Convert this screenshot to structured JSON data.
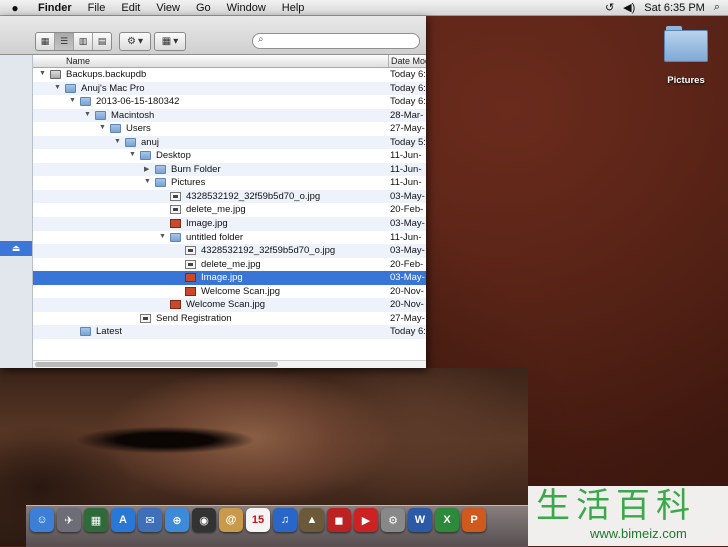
{
  "menubar": {
    "apple": "",
    "app": "Finder",
    "menus": [
      "File",
      "Edit",
      "View",
      "Go",
      "Window",
      "Help"
    ],
    "clock": "Sat 6:35 PM"
  },
  "toolbar": {
    "search_placeholder": ""
  },
  "list": {
    "col_name": "Name",
    "col_date": "Date Mod",
    "rows": [
      {
        "name": "Backups.backupdb",
        "date": "Today 6:",
        "indent": 0,
        "tri": "▼",
        "icon": "disk"
      },
      {
        "name": "Anuj's Mac Pro",
        "date": "Today 6:",
        "indent": 1,
        "tri": "▼",
        "icon": "folder"
      },
      {
        "name": "2013-06-15-180342",
        "date": "Today 6:",
        "indent": 2,
        "tri": "▼",
        "icon": "folder"
      },
      {
        "name": "Macintosh",
        "date": "28-Mar-",
        "indent": 3,
        "tri": "▼",
        "icon": "folder"
      },
      {
        "name": "Users",
        "date": "27-May-",
        "indent": 4,
        "tri": "▼",
        "icon": "folder"
      },
      {
        "name": "anuj",
        "date": "Today 5:",
        "indent": 5,
        "tri": "▼",
        "icon": "folder"
      },
      {
        "name": "Desktop",
        "date": "11-Jun-",
        "indent": 6,
        "tri": "▼",
        "icon": "folder"
      },
      {
        "name": "Burn Folder",
        "date": "11-Jun-",
        "indent": 7,
        "tri": "▶",
        "icon": "folder"
      },
      {
        "name": "Pictures",
        "date": "11-Jun-",
        "indent": 7,
        "tri": "▼",
        "icon": "folder"
      },
      {
        "name": "4328532192_32f59b5d70_o.jpg",
        "date": "03-May-",
        "indent": 8,
        "tri": "",
        "icon": "file"
      },
      {
        "name": "delete_me.jpg",
        "date": "20-Feb-",
        "indent": 8,
        "tri": "",
        "icon": "file"
      },
      {
        "name": "Image.jpg",
        "date": "03-May-",
        "indent": 8,
        "tri": "",
        "icon": "img-red"
      },
      {
        "name": "untitled folder",
        "date": "11-Jun-",
        "indent": 8,
        "tri": "▼",
        "icon": "folder"
      },
      {
        "name": "4328532192_32f59b5d70_o.jpg",
        "date": "03-May-",
        "indent": 9,
        "tri": "",
        "icon": "file"
      },
      {
        "name": "delete_me.jpg",
        "date": "20-Feb-",
        "indent": 9,
        "tri": "",
        "icon": "file"
      },
      {
        "name": "Image.jpg",
        "date": "03-May-",
        "indent": 9,
        "tri": "",
        "icon": "img-red",
        "selected": true
      },
      {
        "name": "Welcome Scan.jpg",
        "date": "20-Nov-",
        "indent": 9,
        "tri": "",
        "icon": "img-red"
      },
      {
        "name": "Welcome Scan.jpg",
        "date": "20-Nov-",
        "indent": 8,
        "tri": "",
        "icon": "img-red"
      },
      {
        "name": "Send Registration",
        "date": "27-May-",
        "indent": 6,
        "tri": "",
        "icon": "file"
      },
      {
        "name": "Latest",
        "date": "Today 6:",
        "indent": 2,
        "tri": "",
        "icon": "folder"
      }
    ]
  },
  "desktop": {
    "icon_label": "Pictures"
  },
  "dock": {
    "items": [
      {
        "name": "finder",
        "color": "#3d7fd6",
        "glyph": "☺"
      },
      {
        "name": "launchpad",
        "color": "#6d6d78",
        "glyph": "✈"
      },
      {
        "name": "mission-control",
        "color": "#2f6b3a",
        "glyph": "▦"
      },
      {
        "name": "app-store",
        "color": "#2a78d6",
        "glyph": "A"
      },
      {
        "name": "mail",
        "color": "#3e6fb8",
        "glyph": "✉"
      },
      {
        "name": "safari",
        "color": "#3c8ad8",
        "glyph": "⊕"
      },
      {
        "name": "facetime",
        "color": "#333",
        "glyph": "◉"
      },
      {
        "name": "contacts",
        "color": "#c99a4b",
        "glyph": "@"
      },
      {
        "name": "calendar",
        "color": "#f4f4f4",
        "glyph": "15"
      },
      {
        "name": "itunes",
        "color": "#2a66c8",
        "glyph": "♫"
      },
      {
        "name": "iphoto",
        "color": "#6b5a3a",
        "glyph": "▲"
      },
      {
        "name": "photo-booth",
        "color": "#b22",
        "glyph": "◼"
      },
      {
        "name": "dvd-player",
        "color": "#c22",
        "glyph": "▶"
      },
      {
        "name": "system-prefs",
        "color": "#888",
        "glyph": "⚙"
      },
      {
        "name": "word",
        "color": "#2b5aa8",
        "glyph": "W"
      },
      {
        "name": "excel",
        "color": "#2d8a3a",
        "glyph": "X"
      },
      {
        "name": "powerpoint",
        "color": "#d05a1e",
        "glyph": "P"
      }
    ]
  },
  "watermark": {
    "chars": "生活百科",
    "url": "www.bimeiz.com"
  }
}
